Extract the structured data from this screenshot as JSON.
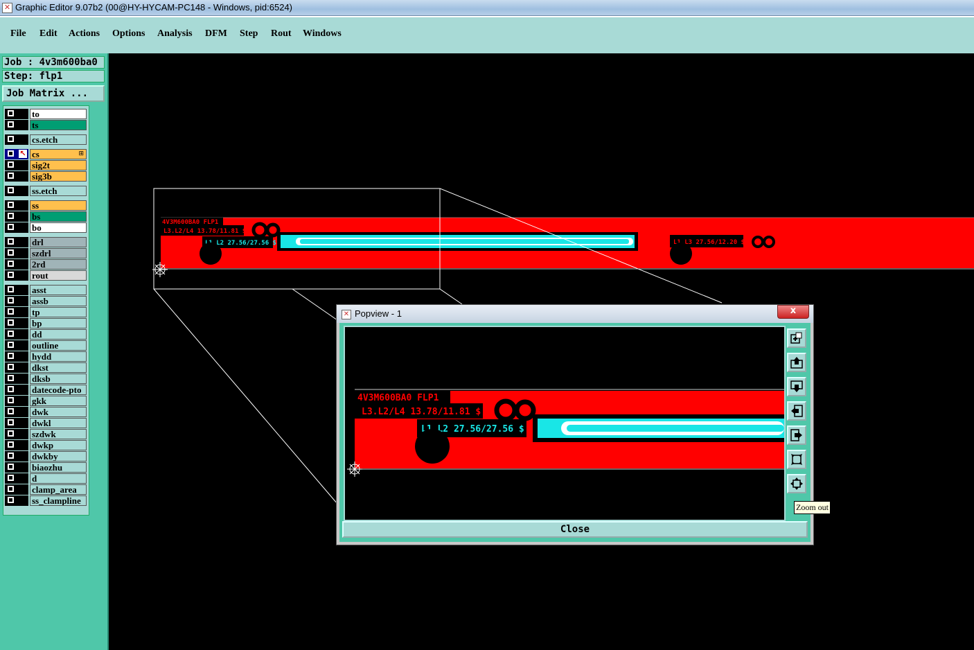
{
  "window": {
    "title": "Graphic Editor 9.07b2 (00@HY-HYCAM-PC148 - Windows, pid:6524)"
  },
  "menu": [
    "File",
    "Edit",
    "Actions",
    "Options",
    "Analysis",
    "DFM",
    "Step",
    "Rout",
    "Windows"
  ],
  "job": {
    "job_label": "Job : 4v3m600ba0",
    "step_label": "Step: flp1",
    "matrix_button": "Job Matrix ..."
  },
  "layers": [
    {
      "name": "to",
      "color": "#ffffff"
    },
    {
      "name": "ts",
      "color": "#009e73"
    },
    {
      "name": "cs.etch",
      "color": "#a8dad6"
    },
    {
      "name": "cs",
      "color": "#ffc04d",
      "active": true
    },
    {
      "name": "sig2t",
      "color": "#ffc04d"
    },
    {
      "name": "sig3b",
      "color": "#ffc04d"
    },
    {
      "name": "ss.etch",
      "color": "#a8dad6"
    },
    {
      "name": "ss",
      "color": "#ffc04d"
    },
    {
      "name": "bs",
      "color": "#009e73"
    },
    {
      "name": "bo",
      "color": "#ffffff"
    },
    {
      "name": "drl",
      "color": "#a0b4b8"
    },
    {
      "name": "szdrl",
      "color": "#a0b4b8"
    },
    {
      "name": "2rd",
      "color": "#a0b4b8"
    },
    {
      "name": "rout",
      "color": "#d9d9d9"
    },
    {
      "name": "asst",
      "color": "#a8dad6"
    },
    {
      "name": "assb",
      "color": "#a8dad6"
    },
    {
      "name": "tp",
      "color": "#a8dad6"
    },
    {
      "name": "bp",
      "color": "#a8dad6"
    },
    {
      "name": "dd",
      "color": "#a8dad6"
    },
    {
      "name": "outline",
      "color": "#a8dad6"
    },
    {
      "name": "hydd",
      "color": "#a8dad6"
    },
    {
      "name": "dkst",
      "color": "#a8dad6"
    },
    {
      "name": "dksb",
      "color": "#a8dad6"
    },
    {
      "name": "datecode-pto",
      "color": "#a8dad6"
    },
    {
      "name": "gkk",
      "color": "#a8dad6"
    },
    {
      "name": "dwk",
      "color": "#a8dad6"
    },
    {
      "name": "dwkl",
      "color": "#a8dad6"
    },
    {
      "name": "szdwk",
      "color": "#a8dad6"
    },
    {
      "name": "dwkp",
      "color": "#a8dad6"
    },
    {
      "name": "dwkby",
      "color": "#a8dad6"
    },
    {
      "name": "biaozhu",
      "color": "#a8dad6"
    },
    {
      "name": "d",
      "color": "#a8dad6"
    },
    {
      "name": "clamp_area",
      "color": "#a8dad6"
    },
    {
      "name": "ss_clampline",
      "color": "#a8dad6"
    }
  ],
  "canvas_text": {
    "job_step": "4V3M600BA0 FLP1",
    "l3l2": "L3.L2/L4 13.78/11.81 $",
    "l1l2": "L1.L2 27.56/27.56 $",
    "l1l3": "L1.L3 27.56/12.20 $"
  },
  "popup": {
    "title": "Popview - 1",
    "close_x": "x",
    "close_button": "Close",
    "tooltip": "Zoom out"
  },
  "colors": {
    "pcb_red": "#ff0000",
    "cyan": "#19e6e6",
    "panel_green": "#4fc7a9",
    "panel_light": "#a8dad6"
  }
}
